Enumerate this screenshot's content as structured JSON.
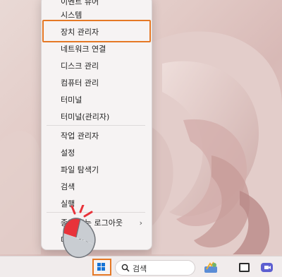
{
  "menu": {
    "items": [
      {
        "label": "이벤트 뷰어"
      },
      {
        "label": "시스템"
      },
      {
        "label": "장치 관리자"
      },
      {
        "label": "네트워크 연결"
      },
      {
        "label": "디스크 관리"
      },
      {
        "label": "컴퓨터 관리"
      },
      {
        "label": "터미널"
      },
      {
        "label": "터미널(관리자)"
      },
      {
        "label": "작업 관리자"
      },
      {
        "label": "설정"
      },
      {
        "label": "파일 탐색기"
      },
      {
        "label": "검색"
      },
      {
        "label": "실행"
      },
      {
        "label": "종료 또는 로그아웃",
        "has_submenu": true
      },
      {
        "label": "데스크톱"
      }
    ],
    "highlighted_item": "장치 관리자"
  },
  "taskbar": {
    "search_label": "검색",
    "icons": [
      "start-button",
      "search-icon",
      "widgets-icon",
      "file-explorer-icon",
      "video-chat-icon"
    ]
  },
  "colors": {
    "highlight": "#e57825",
    "cursor_click": "#e8333a",
    "start_logo": "#1673d6"
  }
}
